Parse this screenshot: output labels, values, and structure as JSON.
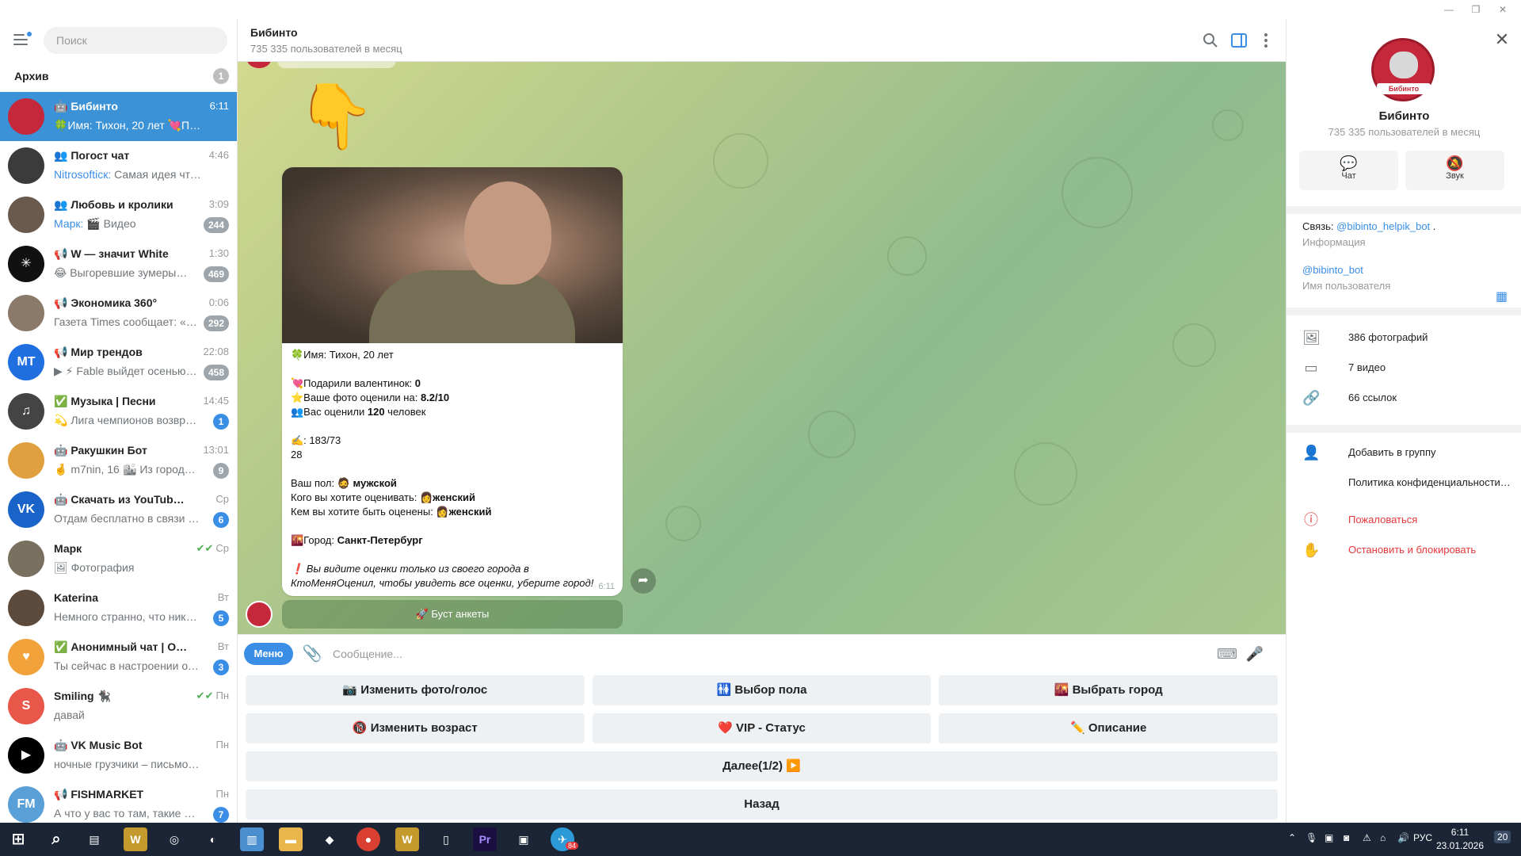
{
  "window": {
    "minimize": "—",
    "restore": "❐",
    "close": "✕"
  },
  "sidebar": {
    "search_placeholder": "Поиск",
    "archive_label": "Архив",
    "archive_count": "1",
    "chats": [
      {
        "name": "🤖 Бибинто",
        "time": "6:11",
        "who": "",
        "preview": "🍀Имя: Тихон, 20 лет 💘Пода…",
        "badge": "",
        "avatar_color": "#c4283a",
        "avatar_text": ""
      },
      {
        "name": "👥 Погост чат",
        "time": "4:46",
        "who": "Nitrosofticк:",
        "preview": " Самая идея что кинос…",
        "badge": "",
        "avatar_color": "#3b3b3b",
        "avatar_text": ""
      },
      {
        "name": "👥 Любовь и кролики",
        "time": "3:09",
        "who": "Марк:",
        "preview": " 🎬 Видео",
        "badge": "244",
        "avatar_color": "#6a5a4d",
        "avatar_text": ""
      },
      {
        "name": "📢 W — значит White",
        "time": "1:30",
        "who": "",
        "preview": "😂 Выгоревшие зумеры…",
        "badge": "469",
        "avatar_color": "#111111",
        "avatar_text": "✳"
      },
      {
        "name": "📢 Экономика 360°",
        "time": "0:06",
        "who": "",
        "preview": "Газета Times сообщает: «Ата…",
        "badge": "292",
        "avatar_color": "#8b7a6a",
        "avatar_text": ""
      },
      {
        "name": "📢 Мир трендов",
        "time": "22:08",
        "who": "",
        "preview": "▶ ⚡ Fable выйдет осенью…",
        "badge": "458",
        "avatar_color": "#1f6fe0",
        "avatar_text": "MT"
      },
      {
        "name": "✅ Музыка | Песни",
        "time": "14:45",
        "who": "",
        "preview": "💫 Лига чемпионов возвр…",
        "badge": "1",
        "badge_blue": true,
        "avatar_color": "#444444",
        "avatar_text": "♫"
      },
      {
        "name": "🤖 Ракушкин Бот",
        "time": "13:01",
        "who": "",
        "preview": "🤞 m7nin, 16 🏙 Из город…",
        "badge": "9",
        "avatar_color": "#e0a040",
        "avatar_text": ""
      },
      {
        "name": "🤖 Скачать из YouTube RuTu…",
        "time": "Ср",
        "who": "",
        "preview": "Отдам бесплатно в связи с пе…",
        "badge": "6",
        "badge_blue": true,
        "avatar_color": "#1a63c9",
        "avatar_text": "VK"
      },
      {
        "name": "Марк",
        "time": "Ср",
        "who": "",
        "preview": "🖼 Фотография",
        "badge": "",
        "check": true,
        "avatar_color": "#7a7060",
        "avatar_text": ""
      },
      {
        "name": "Katerina",
        "time": "Вт",
        "who": "",
        "preview": "Немного странно, что никак …",
        "badge": "5",
        "badge_blue": true,
        "avatar_color": "#5c4a3c",
        "avatar_text": ""
      },
      {
        "name": "✅ Анонимный чат | Общен…",
        "time": "Вт",
        "who": "",
        "preview": "Ты сейчас в настроении отвеч…",
        "badge": "3",
        "badge_blue": true,
        "avatar_color": "#f2a23a",
        "avatar_text": "♥"
      },
      {
        "name": "Smiling 🐈‍⬛",
        "time": "Пн",
        "who": "",
        "preview": "давай",
        "badge": "",
        "check": true,
        "avatar_color": "#e8574a",
        "avatar_text": "S"
      },
      {
        "name": "🤖 VK Music Bot",
        "time": "Пн",
        "who": "",
        "preview": "ночные грузчики – письмо издат…",
        "badge": "",
        "avatar_color": "#000000",
        "avatar_text": "▶"
      },
      {
        "name": "📢 FISHMARKET",
        "time": "Пн",
        "who": "",
        "preview": "А что у вас то там, такие ж…",
        "badge": "7",
        "badge_blue": true,
        "avatar_color": "#5aa0d8",
        "avatar_text": "FM"
      }
    ]
  },
  "main": {
    "title": "Бибинто",
    "subtitle": "735 335 пользователей в месяц",
    "message": {
      "lines": [
        {
          "text": "🍀Имя: Тихон, 20 лет"
        },
        {
          "gap": true
        },
        {
          "pre": "💘Подарили валентинок: ",
          "bold": "0"
        },
        {
          "pre": "⭐Ваше фото оценили на: ",
          "bold": "8.2/10"
        },
        {
          "pre": "👥Вас оценили ",
          "bold": "120",
          "post": " человек"
        },
        {
          "gap": true
        },
        {
          "text": "✍️: 183/73"
        },
        {
          "text": "28"
        },
        {
          "gap": true
        },
        {
          "pre": "Ваш пол: 🧔 ",
          "bold": "мужской"
        },
        {
          "pre": "Кого вы хотите оценивать: 👩",
          "bold": "женский"
        },
        {
          "pre": "Кем вы хотите быть оценены: 👩",
          "bold": "женский"
        },
        {
          "gap": true
        },
        {
          "pre": "🌇Город: ",
          "bold": "Санкт-Петербург"
        },
        {
          "gap": true
        }
      ],
      "italic": "❗ Вы видите оценки только из своего города в КтоМеняОценил, чтобы увидеть все оценки, уберите город!",
      "time": "6:11"
    },
    "hand": "👇",
    "boost_label": "🚀 Буст анкеты",
    "composer": {
      "menu_label": "Меню",
      "placeholder": "Сообщение..."
    },
    "keyboard": [
      [
        "📷 Изменить фото/голос",
        "🚻 Выбор пола",
        "🌇 Выбрать город"
      ],
      [
        "🔞 Изменить возраст",
        "❤️ VIP - Статус",
        "✏️ Описание"
      ],
      [
        "Далее(1/2) ▶️"
      ],
      [
        "Назад"
      ]
    ]
  },
  "profile": {
    "avatar_label": "Бибинто",
    "name": "Бибинто",
    "subtitle": "735 335 пользователей в месяц",
    "chat_label": "Чат",
    "sound_label": "Звук",
    "contact_prefix": "Связь: ",
    "contact_link": "@bibinto_helpik_bot",
    "contact_suffix": " .",
    "info_caption": "Информация",
    "username": "@bibinto_bot",
    "username_caption": "Имя пользователя",
    "media": [
      "386 фотографий",
      "7 видео",
      "66 ссылок"
    ],
    "actions": [
      "Добавить в группу",
      "Политика конфиденциальности…"
    ],
    "danger": [
      "Пожаловаться",
      "Остановить и блокировать"
    ]
  },
  "taskbar": {
    "lang": "РУС",
    "time": "6:11",
    "date": "23.01.2026",
    "notif": "20",
    "tg_badge": "84"
  }
}
